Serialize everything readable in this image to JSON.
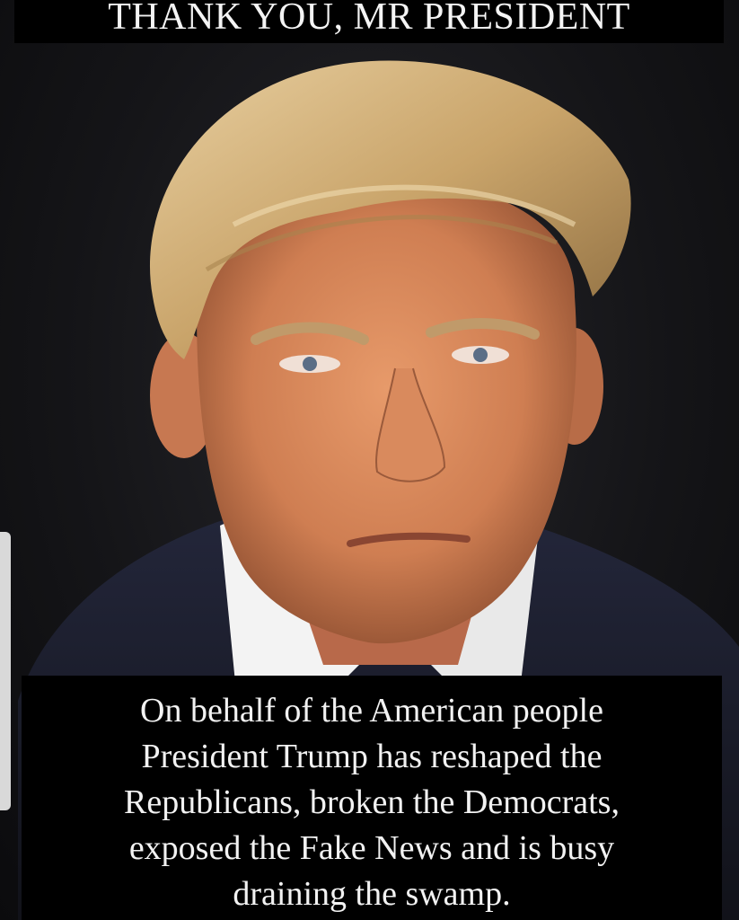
{
  "headline": {
    "text": "THANK YOU, MR PRESIDENT"
  },
  "caption": {
    "lines": [
      "On behalf of the American people",
      "President Trump has reshaped the",
      "Republicans, broken the Democrats,",
      "exposed the Fake News and is busy",
      "draining the swamp."
    ]
  },
  "colors": {
    "background": "#151518",
    "banner": "#000000",
    "text": "#f2f2f2",
    "hair": "#c9a46a",
    "skin": "#d9875a",
    "suit": "#1b1d26",
    "shirt": "#f3f3f3"
  }
}
